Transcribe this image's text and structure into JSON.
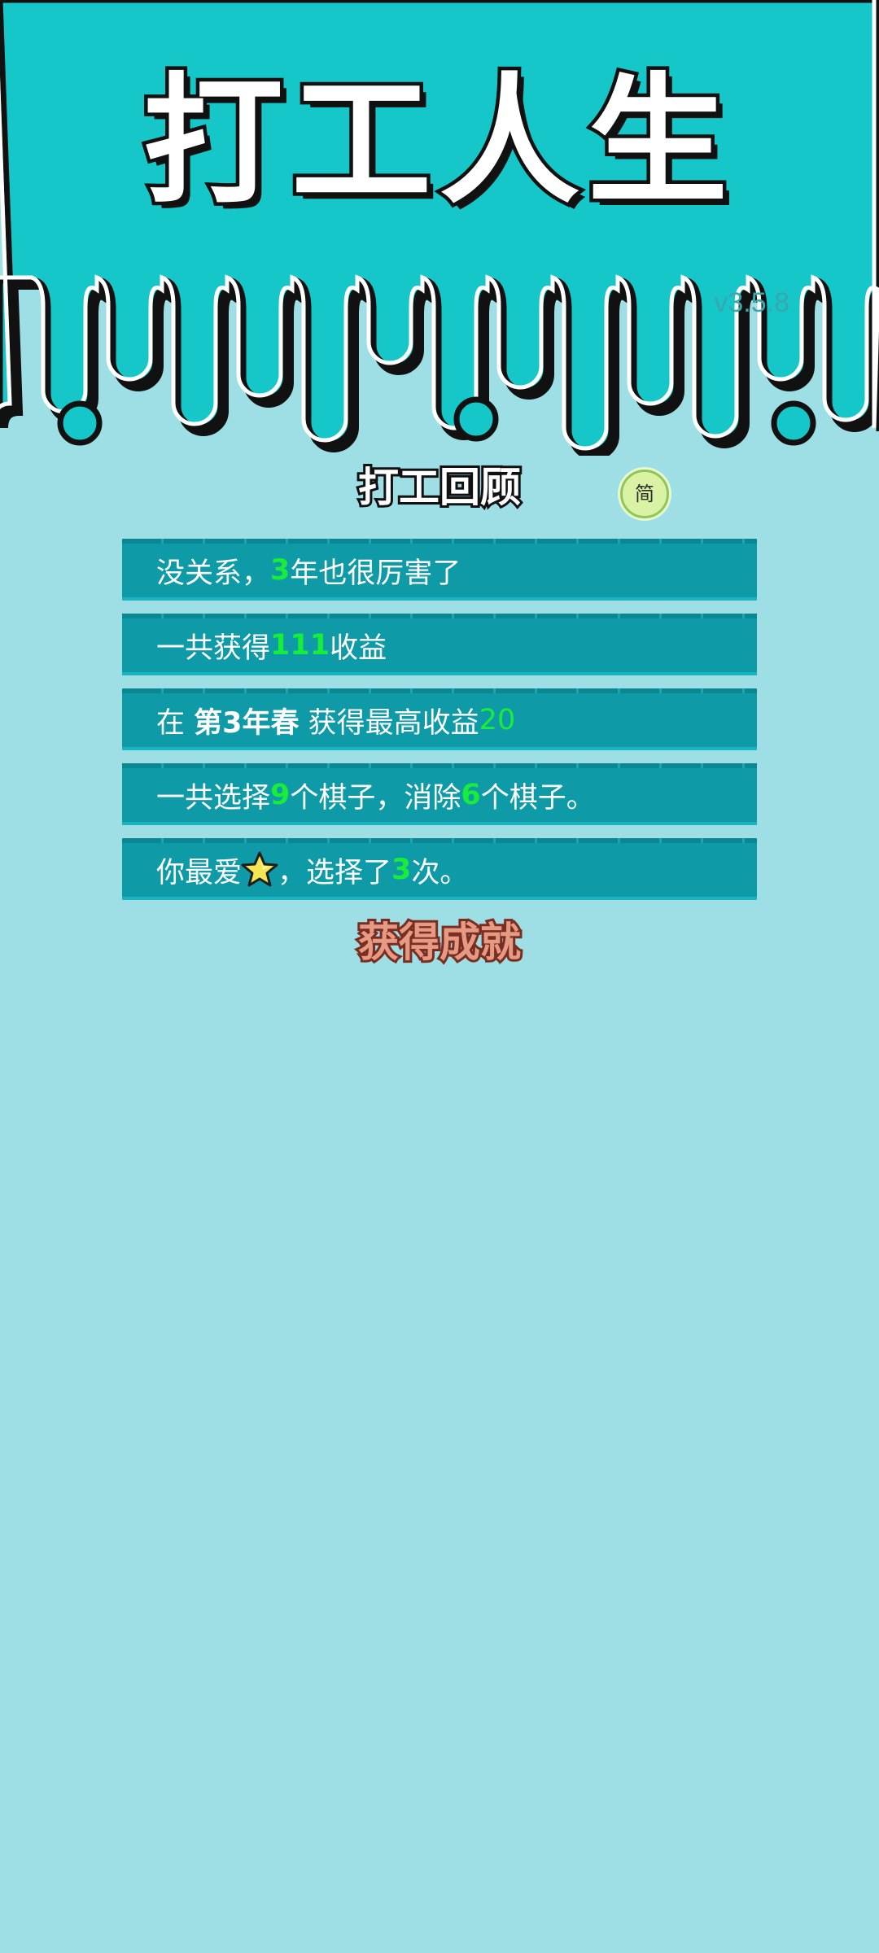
{
  "game": {
    "title": "打工人生",
    "version": "v3.5.8"
  },
  "review": {
    "title": "打工回顾",
    "lang_toggle": "简",
    "rows": {
      "r1": {
        "a": "没关系，",
        "years": "3",
        "b": "年也很厉害了"
      },
      "r2": {
        "a": "一共获得",
        "total": "111",
        "b": "收益"
      },
      "r3": {
        "a": "在 ",
        "season": "第3年春",
        "b": " 获得最高收益",
        "max": "20"
      },
      "r4": {
        "a": "一共选择",
        "chosen": "9",
        "b": "个棋子，消除",
        "removed": "6",
        "c": "个棋子。"
      },
      "r5": {
        "a": "你最爱",
        "icon": "star-icon",
        "b": "，选择了",
        "times": "3",
        "c": "次。"
      }
    }
  },
  "achievements": {
    "title": "获得成就"
  },
  "colors": {
    "header_bg": "#15c7c9",
    "page_bg": "#9ddfe5",
    "row_bg": "#0e9aa6",
    "highlight": "#18ee3a",
    "achievement_text": "#e69a83"
  }
}
